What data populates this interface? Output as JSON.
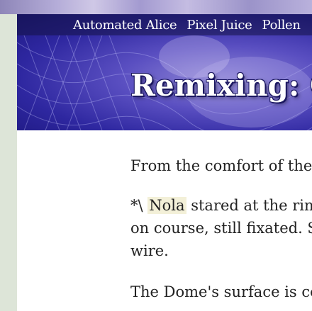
{
  "nav": {
    "items": [
      {
        "label": "Automated Alice"
      },
      {
        "label": "Pixel Juice"
      },
      {
        "label": "Pollen"
      }
    ]
  },
  "banner": {
    "title": "Remixing: Cl"
  },
  "article": {
    "p1": "From the comfort of the br",
    "p2_prefix": "*\\ ",
    "p2_highlight": "Nola",
    "p2_rest": " stared at the ring-f",
    "p2_line2": "on course, still fixated. Siler",
    "p2_line3": "wire.",
    "p3": "The Dome's surface is const"
  },
  "colors": {
    "banner_dark": "#1d1880",
    "banner_mid": "#5a4fc1",
    "nav_text": "#ffffff",
    "body_text": "#222222",
    "highlight": "#f3f0d8",
    "side_strip": "#dde5d8"
  }
}
